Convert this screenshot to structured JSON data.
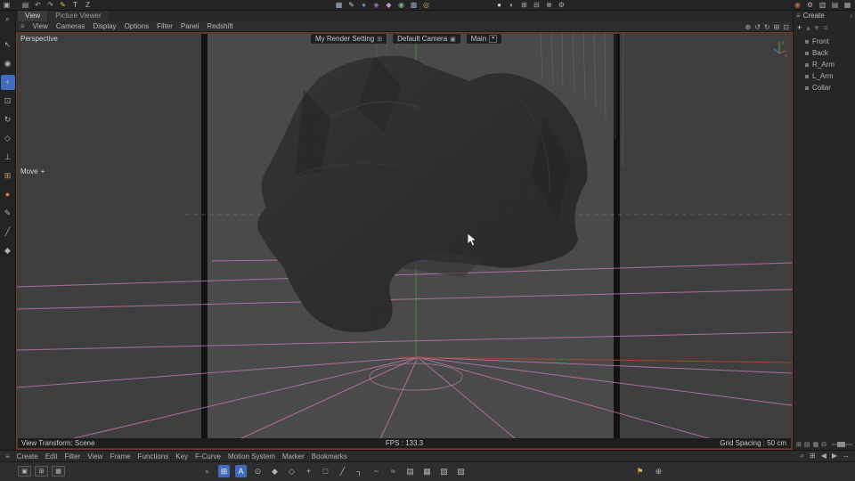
{
  "colors": {
    "viewport_border": "#7e3424",
    "grid_pink": "#c878b4",
    "axis_green": "#3f8f3f",
    "axis_red": "#a8462e",
    "selection_blue": "#3f6cc0"
  },
  "top_menubar": {
    "app_icon": {
      "name": "app-icon",
      "glyph": "▣"
    },
    "group1": [
      {
        "name": "file-new-icon",
        "glyph": "▤"
      },
      {
        "name": "undo-icon",
        "glyph": "↶"
      },
      {
        "name": "redo-icon",
        "glyph": "↷"
      },
      {
        "name": "pen-tool-icon",
        "glyph": "✎",
        "color": "#d8c050"
      },
      {
        "name": "track-icon",
        "glyph": "T",
        "color": "#c8c8c8"
      },
      {
        "name": "zero-icon",
        "glyph": "Z",
        "color": "#b8b8b8"
      }
    ],
    "group2": [
      {
        "name": "add-cube-icon",
        "glyph": "▦",
        "color": "#a8bcd8"
      },
      {
        "name": "pen-spline-icon",
        "glyph": "✎",
        "color": "#c8c8c8"
      },
      {
        "name": "add-sphere-icon",
        "glyph": "●",
        "color": "#6a8ad0"
      },
      {
        "name": "cloner-icon",
        "glyph": "◈",
        "color": "#a87ad0"
      },
      {
        "name": "deformer-icon",
        "glyph": "◆",
        "color": "#c890d8"
      },
      {
        "name": "field-icon",
        "glyph": "◉",
        "color": "#7ab08a"
      },
      {
        "name": "volume-icon",
        "glyph": "▩",
        "color": "#90a0b8"
      },
      {
        "name": "dynamics-icon",
        "glyph": "◎",
        "color": "#c8a860"
      }
    ],
    "group3": [
      {
        "name": "material-icon",
        "glyph": "●",
        "color": "#d0d0d0"
      },
      {
        "name": "uv-icon",
        "glyph": "◐"
      },
      {
        "name": "layout-grid-icon",
        "glyph": "⊞"
      },
      {
        "name": "snap-settings-icon",
        "glyph": "⊟"
      },
      {
        "name": "axis-mode-icon",
        "glyph": "⊕"
      },
      {
        "name": "preferences-icon",
        "glyph": "⚙"
      }
    ],
    "right": [
      {
        "name": "render-button-icon",
        "glyph": "◉",
        "color": "#c06450"
      },
      {
        "name": "render-settings-icon",
        "glyph": "⚙"
      },
      {
        "name": "interface-layout-icon",
        "glyph": "▥"
      },
      {
        "name": "panel-toggle-icon",
        "glyph": "▤"
      },
      {
        "name": "help-icon",
        "glyph": "▦"
      }
    ]
  },
  "tabs": [
    {
      "label": "View",
      "name": "tab-view",
      "active": true
    },
    {
      "label": "Picture Viewer",
      "name": "tab-picture-viewer"
    }
  ],
  "viewport_menu": {
    "burger": "≡",
    "items": [
      {
        "label": "View",
        "name": "viewport-menu-view"
      },
      {
        "label": "Cameras",
        "name": "viewport-menu-cameras"
      },
      {
        "label": "Display",
        "name": "viewport-menu-display"
      },
      {
        "label": "Options",
        "name": "viewport-menu-options"
      },
      {
        "label": "Filter",
        "name": "viewport-menu-filter"
      },
      {
        "label": "Panel",
        "name": "viewport-menu-panel"
      },
      {
        "label": "Redshift",
        "name": "viewport-menu-redshift"
      }
    ],
    "right_icons": [
      {
        "name": "pan-view-icon",
        "glyph": "⊕"
      },
      {
        "name": "undo-view-icon",
        "glyph": "↺"
      },
      {
        "name": "redo-view-icon",
        "glyph": "↻"
      },
      {
        "name": "split-view-icon",
        "glyph": "⊞"
      },
      {
        "name": "maximize-view-icon",
        "glyph": "⊡"
      }
    ]
  },
  "left_toolbar": {
    "items": [
      {
        "name": "zoom-icon",
        "glyph": "⌕"
      },
      {
        "name": "select-tool-icon",
        "glyph": "↖"
      },
      {
        "name": "live-selection-icon",
        "glyph": "◉"
      },
      {
        "name": "move-tool-icon",
        "glyph": "+",
        "active": true
      },
      {
        "name": "scale-tool-icon",
        "glyph": "⊡"
      },
      {
        "name": "rotate-tool-icon",
        "glyph": "↻"
      },
      {
        "name": "last-tool-icon",
        "glyph": "◇"
      },
      {
        "name": "axis-lock-icon",
        "glyph": "⊥"
      },
      {
        "name": "workplane-icon",
        "glyph": "⊞",
        "color": "#d09a5a"
      },
      {
        "name": "snap-icon",
        "glyph": "●",
        "color": "#d0824a"
      },
      {
        "name": "brush-tool-icon",
        "glyph": "✎"
      },
      {
        "name": "knife-tool-icon",
        "glyph": "╱"
      },
      {
        "name": "magnet-tool-icon",
        "glyph": "◆"
      }
    ]
  },
  "viewport": {
    "projection_label": "Perspective",
    "controls": {
      "render_setting_label": "My Render Setting",
      "render_setting_icon": "⊞",
      "camera_label": "Default Camera",
      "camera_icon": "▣",
      "take_label": "Main",
      "take_dropdown_icon": "▾"
    },
    "move_label": "Move",
    "move_icon": "+",
    "status": {
      "left": "View Transform: Scene",
      "center": "FPS : 133.3",
      "right": "Grid Spacing : 50 cm"
    }
  },
  "right_panel": {
    "burger": "≡",
    "menu_label": "Create",
    "chevron": "›",
    "header_icons": [
      {
        "name": "add-object-icon",
        "glyph": "+"
      },
      {
        "name": "move-up-icon",
        "glyph": "▴",
        "dim": true
      },
      {
        "name": "move-down-icon",
        "glyph": "▾",
        "dim": true
      },
      {
        "name": "panel-menu-icon",
        "glyph": "≡",
        "dim": true
      }
    ],
    "objects": [
      {
        "label": "Front",
        "name": "object-item-front"
      },
      {
        "label": "Back",
        "name": "object-item-back"
      },
      {
        "label": "R_Arm",
        "name": "object-item-r-arm"
      },
      {
        "label": "L_Arm",
        "name": "object-item-l-arm"
      },
      {
        "label": "Collar",
        "name": "object-item-collar"
      }
    ],
    "bottom_icons": [
      {
        "name": "view-small-icon",
        "glyph": "⊞"
      },
      {
        "name": "view-list-icon",
        "glyph": "▤"
      },
      {
        "name": "view-grid-icon",
        "glyph": "▦"
      },
      {
        "name": "view-large-icon",
        "glyph": "⊟"
      }
    ]
  },
  "timeline_menu": {
    "burger": "≡",
    "items": [
      {
        "label": "Create",
        "name": "timeline-menu-create"
      },
      {
        "label": "Edit",
        "name": "timeline-menu-edit"
      },
      {
        "label": "Filter",
        "name": "timeline-menu-filter"
      },
      {
        "label": "View",
        "name": "timeline-menu-view"
      },
      {
        "label": "Frame",
        "name": "timeline-menu-frame"
      },
      {
        "label": "Functions",
        "name": "timeline-menu-functions"
      },
      {
        "label": "Key",
        "name": "timeline-menu-key"
      },
      {
        "label": "F-Curve",
        "name": "timeline-menu-fcurve"
      },
      {
        "label": "Motion System",
        "name": "timeline-menu-motion-system"
      },
      {
        "label": "Marker",
        "name": "timeline-menu-marker"
      },
      {
        "label": "Bookmarks",
        "name": "timeline-menu-bookmarks"
      }
    ],
    "right_icons": [
      {
        "name": "zoom-timeline-icon",
        "glyph": "⌕"
      },
      {
        "name": "frame-all-icon",
        "glyph": "⊞"
      },
      {
        "name": "prev-key-icon",
        "glyph": "◀"
      },
      {
        "name": "next-key-icon",
        "glyph": "▶"
      },
      {
        "name": "pan-timeline-icon",
        "glyph": "↔"
      }
    ]
  },
  "bottom_toolbar": {
    "left_buttons": [
      {
        "name": "snap-toggle-icon",
        "glyph": "▣"
      },
      {
        "name": "grid-toggle-icon",
        "glyph": "⊞"
      },
      {
        "name": "magnet-toggle-icon",
        "glyph": "▦"
      }
    ],
    "icons": [
      {
        "name": "solo-off-icon",
        "glyph": "●",
        "dim": true
      },
      {
        "name": "snap-key-icon",
        "glyph": "⊞",
        "active": true
      },
      {
        "name": "autokey-icon",
        "glyph": "A",
        "active": true
      },
      {
        "name": "keyframe-selection-icon",
        "glyph": "⊙"
      },
      {
        "name": "record-position-icon",
        "glyph": "◆"
      },
      {
        "name": "record-scale-icon",
        "glyph": "◇"
      },
      {
        "name": "record-rotation-icon",
        "glyph": "+"
      },
      {
        "name": "record-parameter-icon",
        "glyph": "□"
      },
      {
        "name": "linear-interp-icon",
        "glyph": "╱"
      },
      {
        "name": "step-interp-icon",
        "glyph": "┐"
      },
      {
        "name": "spline-interp-icon",
        "glyph": "~"
      },
      {
        "name": "ease-interp-icon",
        "glyph": "≈"
      },
      {
        "name": "track-view-icon",
        "glyph": "▤"
      },
      {
        "name": "dope-sheet-icon",
        "glyph": "▦"
      },
      {
        "name": "fcurve-mode-icon",
        "glyph": "▧"
      },
      {
        "name": "motion-mode-icon",
        "glyph": "▨"
      }
    ],
    "right_icons": [
      {
        "name": "pin-icon",
        "glyph": "⚑",
        "color": "#d8b050"
      },
      {
        "name": "target-icon",
        "glyph": "⊕"
      }
    ]
  }
}
